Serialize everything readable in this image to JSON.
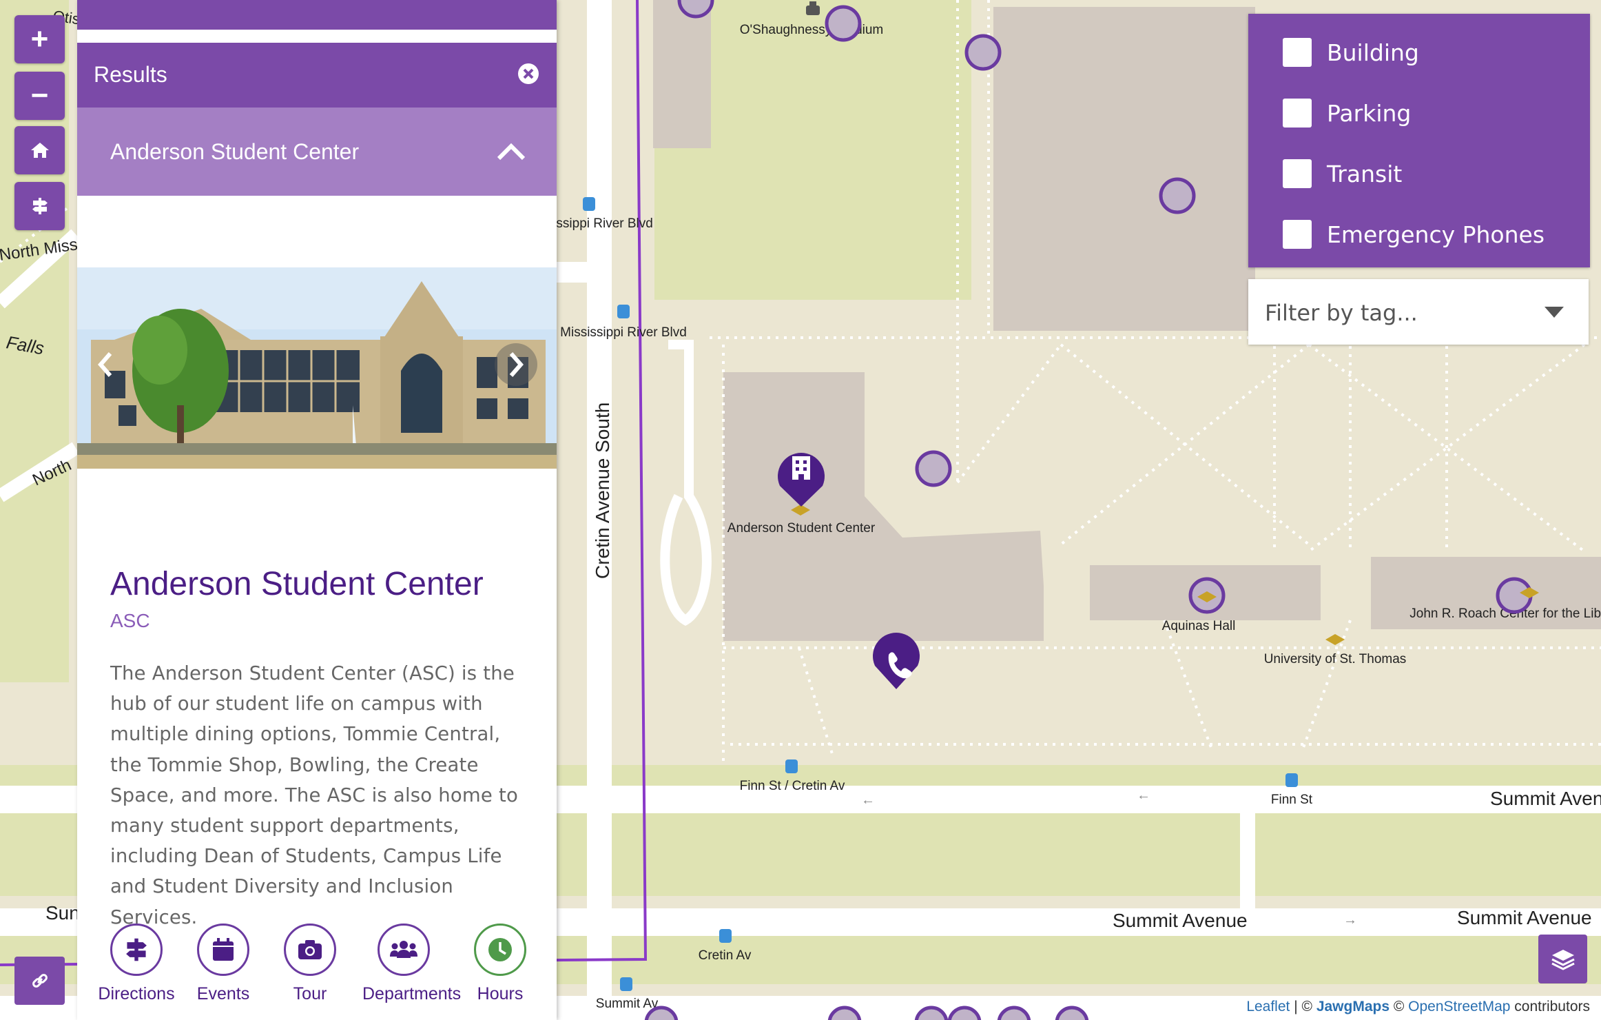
{
  "map": {
    "street_labels": [
      "Cretin Avenue South",
      "Summit Avenue",
      "Summit Avenue",
      "Summit Aven",
      "North Missis",
      "North",
      "Sun",
      "Falls",
      "Otis"
    ],
    "poi_labels": [
      "O'Shaughnessy Stadium",
      "Mississippi River Blvd",
      "Mississippi River Blvd",
      "Anderson Student Center",
      "Aquinas Hall",
      "University of St. Thomas",
      "John R. Roach Center for the Liberal Arts",
      "Finn St / Cretin Av",
      "Finn St",
      "Cretin Av",
      "Summit Av"
    ],
    "colors": {
      "land": "#ebe6d2",
      "green": "#dfe3b3",
      "building": "#d2c9c0",
      "road": "#ffffff",
      "boundary": "#8a3ac8",
      "accent": "#7b4aa8"
    }
  },
  "controls": {
    "zoom_in": "+",
    "zoom_out": "−",
    "home_icon": "home-icon",
    "directions_icon": "signpost-icon",
    "link_icon": "link-icon",
    "layers_icon": "layers-icon"
  },
  "panel": {
    "results_title": "Results",
    "place_bar_title": "Anderson Student Center",
    "place_name": "Anderson Student Center",
    "place_abbr": "ASC",
    "description": "The Anderson Student Center (ASC) is the hub of our student life on campus with multiple dining options, Tommie Central, the Tommie Shop, Bowling, the Create Space, and more. The ASC is also home to many student support departments, including Dean of Students, Campus Life and Student Diversity and Inclusion Services.",
    "actions": [
      {
        "label": "Directions",
        "icon": "signpost-icon"
      },
      {
        "label": "Events",
        "icon": "calendar-icon"
      },
      {
        "label": "Tour",
        "icon": "camera-icon"
      },
      {
        "label": "Departments",
        "icon": "people-icon"
      },
      {
        "label": "Hours",
        "icon": "clock-icon"
      }
    ]
  },
  "filters": {
    "items": [
      {
        "label": "Building",
        "checked": false
      },
      {
        "label": "Parking",
        "checked": false
      },
      {
        "label": "Transit",
        "checked": false
      },
      {
        "label": "Emergency Phones",
        "checked": false
      }
    ],
    "tag_placeholder": "Filter by tag..."
  },
  "attribution": {
    "leaflet": "Leaflet",
    "sep": " | © ",
    "jawg": "JawgMaps",
    "copy": " © ",
    "osm": "OpenStreetMap",
    "tail": " contributors"
  }
}
